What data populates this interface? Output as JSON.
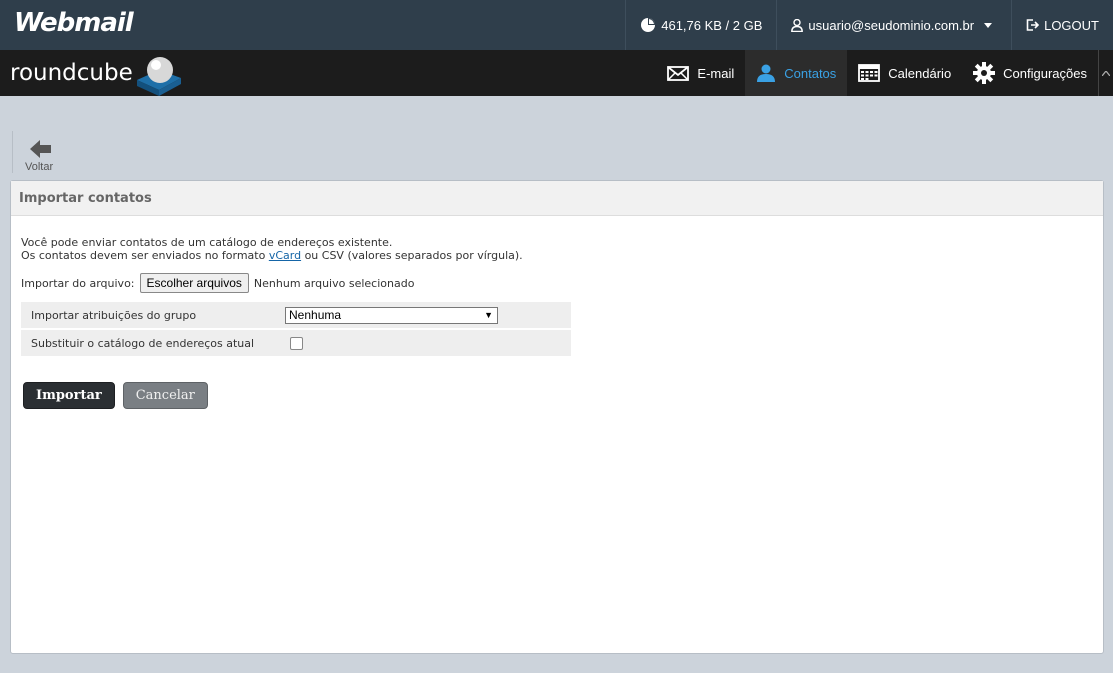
{
  "topbar": {
    "brand": "Webmail",
    "quota": "461,76 KB / 2 GB",
    "user": "usuario@seudominio.com.br",
    "logout": "LOGOUT"
  },
  "navbar": {
    "logo_text": "roundcube",
    "items": [
      {
        "label": "E-mail",
        "icon": "envelope-icon"
      },
      {
        "label": "Contatos",
        "icon": "person-icon",
        "active": true
      },
      {
        "label": "Calendário",
        "icon": "calendar-icon"
      },
      {
        "label": "Configurações",
        "icon": "gear-icon"
      }
    ],
    "accent_color": "#3aa1e4"
  },
  "toolbar": {
    "back_label": "Voltar"
  },
  "panel": {
    "title": "Importar contatos",
    "desc_line1": "Você pode enviar contatos de um catálogo de endereços existente.",
    "desc_line2_pre": "Os contatos devem ser enviados no formato ",
    "desc_link": "vCard",
    "desc_line2_post": " ou CSV (valores separados por vírgula).",
    "file_label": "Importar do arquivo:",
    "file_button": "Escolher arquivos",
    "file_status": "Nenhum arquivo selecionado",
    "group_label": "Importar atribuições do grupo",
    "group_value": "Nenhuma",
    "replace_label": "Substituir o catálogo de endereços atual",
    "import_button": "Importar",
    "cancel_button": "Cancelar"
  }
}
